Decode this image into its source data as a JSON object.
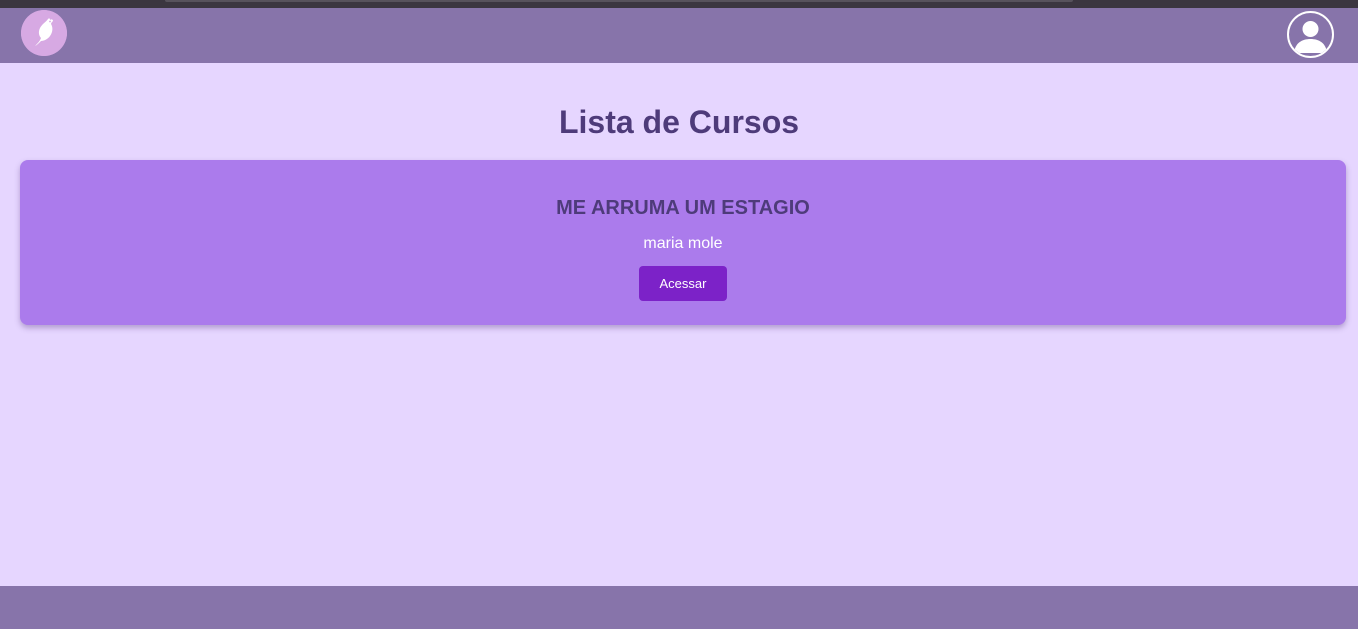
{
  "header": {
    "logo_icon": "bird-logo-icon",
    "profile_icon": "user-avatar-icon"
  },
  "main": {
    "title": "Lista de Cursos",
    "courses": [
      {
        "name": "ME ARRUMA UM ESTAGIO",
        "author": "maria mole",
        "button_label": "Acessar"
      }
    ]
  },
  "colors": {
    "navbar": "#8774aa",
    "page_background": "#e6d6ff",
    "card": "#ab7bec",
    "button": "#7c22c8",
    "title_text": "#4e3b7a"
  }
}
